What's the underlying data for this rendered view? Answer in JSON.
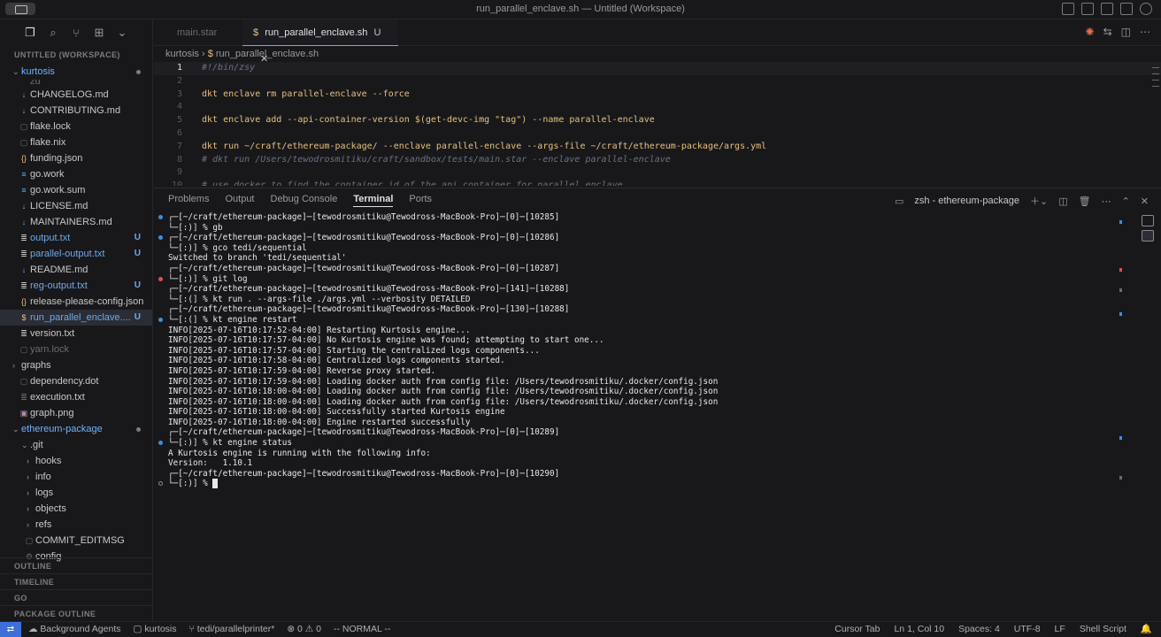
{
  "window": {
    "title": "run_parallel_enclave.sh — Untitled (Workspace)"
  },
  "explorer": {
    "workspace_header": "UNTITLED (WORKSPACE)",
    "root_folder": "kurtosis",
    "clipped_top": "zu",
    "items": [
      {
        "name": "CHANGELOG.md",
        "icon": "markdown-icon",
        "status": ""
      },
      {
        "name": "CONTRIBUTING.md",
        "icon": "markdown-icon",
        "status": ""
      },
      {
        "name": "flake.lock",
        "icon": "file-icon",
        "status": ""
      },
      {
        "name": "flake.nix",
        "icon": "file-icon",
        "status": ""
      },
      {
        "name": "funding.json",
        "icon": "json-icon",
        "status": ""
      },
      {
        "name": "go.work",
        "icon": "go-icon",
        "status": ""
      },
      {
        "name": "go.work.sum",
        "icon": "go-icon",
        "status": ""
      },
      {
        "name": "LICENSE.md",
        "icon": "markdown-icon",
        "status": ""
      },
      {
        "name": "MAINTAINERS.md",
        "icon": "markdown-icon",
        "status": ""
      },
      {
        "name": "output.txt",
        "icon": "text-icon",
        "status": "U"
      },
      {
        "name": "parallel-output.txt",
        "icon": "text-icon",
        "status": "U"
      },
      {
        "name": "README.md",
        "icon": "markdown-icon",
        "status": ""
      },
      {
        "name": "reg-output.txt",
        "icon": "text-icon",
        "status": "U"
      },
      {
        "name": "release-please-config.json",
        "icon": "json-icon",
        "status": ""
      },
      {
        "name": "run_parallel_enclave....",
        "icon": "shell-icon",
        "status": "U"
      },
      {
        "name": "version.txt",
        "icon": "text-icon",
        "status": ""
      },
      {
        "name": "yarn.lock",
        "icon": "file-icon",
        "status": ""
      }
    ],
    "graphs_folder": "graphs",
    "graphs_items": [
      "dependency.dot",
      "execution.txt",
      "graph.png"
    ],
    "eth_folder": "ethereum-package",
    "git_folder": ".git",
    "git_items": [
      "hooks",
      "info",
      "logs",
      "objects",
      "refs"
    ],
    "git_files": [
      "COMMIT_EDITMSG",
      "config"
    ],
    "sections": [
      "OUTLINE",
      "TIMELINE",
      "GO",
      "PACKAGE OUTLINE"
    ]
  },
  "tabs": [
    {
      "label": "main.star"
    },
    {
      "label": "run_parallel_enclave.sh",
      "status": "U"
    }
  ],
  "breadcrumb": [
    "kurtosis",
    "run_parallel_enclave.sh"
  ],
  "editor": {
    "lines": [
      {
        "n": "1",
        "text": "#!/bin/zsy"
      },
      {
        "n": "2",
        "text": ""
      },
      {
        "n": "3",
        "text": "dkt enclave rm parallel-enclave --force"
      },
      {
        "n": "4",
        "text": ""
      },
      {
        "n": "5",
        "text": "dkt enclave add --api-container-version $(get-devc-img \"tag\") --name parallel-enclave"
      },
      {
        "n": "6",
        "text": ""
      },
      {
        "n": "7",
        "text": "dkt run ~/craft/ethereum-package/ --enclave parallel-enclave --args-file ~/craft/ethereum-package/args.yml"
      },
      {
        "n": "8",
        "text": "# dkt run /Users/tewodrosmitiku/craft/sandbox/tests/main.star --enclave parallel-enclave"
      },
      {
        "n": "9",
        "text": ""
      },
      {
        "n": "10",
        "text": "# use docker to find the container id of the api container for parallel enclave"
      }
    ]
  },
  "panel": {
    "tabs": [
      "Problems",
      "Output",
      "Debug Console",
      "Terminal",
      "Ports"
    ],
    "terminal_name": "zsh - ethereum-package",
    "lines": [
      {
        "t": "┌─[~/craft/ethereum-package]─[tewodrosmitiku@Tewodross-MacBook-Pro]─[0]─[10285]",
        "g": "blue"
      },
      {
        "t": "└─[:)] % gb",
        "g": ""
      },
      {
        "t": "┌─[~/craft/ethereum-package]─[tewodrosmitiku@Tewodross-MacBook-Pro]─[0]─[10286]",
        "g": "blue"
      },
      {
        "t": "└─[:)] % gco tedi/sequential",
        "g": ""
      },
      {
        "t": "Switched to branch 'tedi/sequential'",
        "g": ""
      },
      {
        "t": "┌─[~/craft/ethereum-package]─[tewodrosmitiku@Tewodross-MacBook-Pro]─[0]─[10287]",
        "g": ""
      },
      {
        "t": "└─[:)] % git log",
        "g": "red"
      },
      {
        "t": "┌─[~/craft/ethereum-package]─[tewodrosmitiku@Tewodross-MacBook-Pro]─[141]─[10288]",
        "g": ""
      },
      {
        "t": "└─[:(] % kt run . --args-file ./args.yml --verbosity DETAILED",
        "g": ""
      },
      {
        "t": "┌─[~/craft/ethereum-package]─[tewodrosmitiku@Tewodross-MacBook-Pro]─[130]─[10288]",
        "g": ""
      },
      {
        "t": "└─[:(] % kt engine restart",
        "g": "blue"
      },
      {
        "t": "INFO[2025-07-16T10:17:52-04:00] Restarting Kurtosis engine...",
        "g": ""
      },
      {
        "t": "INFO[2025-07-16T10:17:57-04:00] No Kurtosis engine was found; attempting to start one...",
        "g": ""
      },
      {
        "t": "INFO[2025-07-16T10:17:57-04:00] Starting the centralized logs components...",
        "g": ""
      },
      {
        "t": "INFO[2025-07-16T10:17:58-04:00] Centralized logs components started.",
        "g": ""
      },
      {
        "t": "INFO[2025-07-16T10:17:59-04:00] Reverse proxy started.",
        "g": ""
      },
      {
        "t": "INFO[2025-07-16T10:17:59-04:00] Loading docker auth from config file: /Users/tewodrosmitiku/.docker/config.json",
        "g": ""
      },
      {
        "t": "INFO[2025-07-16T10:18:00-04:00] Loading docker auth from config file: /Users/tewodrosmitiku/.docker/config.json",
        "g": ""
      },
      {
        "t": "INFO[2025-07-16T10:18:00-04:00] Loading docker auth from config file: /Users/tewodrosmitiku/.docker/config.json",
        "g": ""
      },
      {
        "t": "INFO[2025-07-16T10:18:00-04:00] Successfully started Kurtosis engine",
        "g": ""
      },
      {
        "t": "INFO[2025-07-16T10:18:00-04:00] Engine restarted successfully",
        "g": ""
      },
      {
        "t": "┌─[~/craft/ethereum-package]─[tewodrosmitiku@Tewodross-MacBook-Pro]─[0]─[10289]",
        "g": ""
      },
      {
        "t": "└─[:)] % kt engine status",
        "g": "blue"
      },
      {
        "t": "A Kurtosis engine is running with the following info:",
        "g": ""
      },
      {
        "t": "Version:   1.10.1",
        "g": ""
      },
      {
        "t": "┌─[~/craft/ethereum-package]─[tewodrosmitiku@Tewodross-MacBook-Pro]─[0]─[10290]",
        "g": ""
      },
      {
        "t": "└─[:)] % ",
        "g": "hollow",
        "cursor": true
      }
    ]
  },
  "statusbar": {
    "left": [
      "Background Agents",
      "kurtosis",
      "tedi/parallelprinter*",
      "⊗ 0  ⚠ 0",
      "-- NORMAL --"
    ],
    "right": [
      "Cursor Tab",
      "Ln 1, Col 10",
      "Spaces: 4",
      "UTF-8",
      "LF",
      "Shell Script"
    ]
  }
}
